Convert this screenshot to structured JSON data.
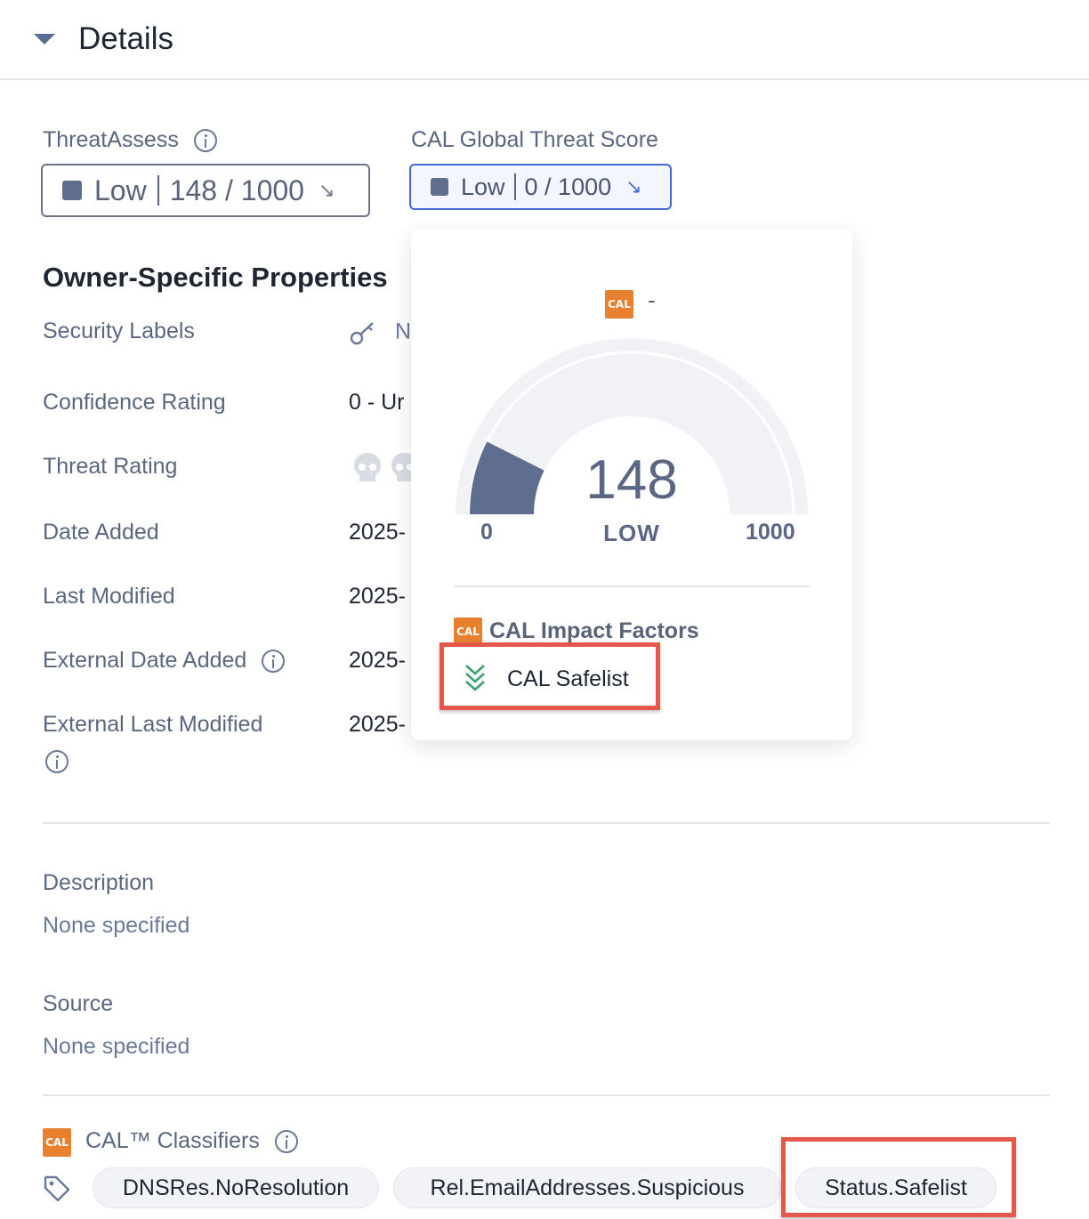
{
  "header": {
    "title": "Details"
  },
  "threat_assess": {
    "label": "ThreatAssess",
    "level": "Low",
    "score": "148 / 1000"
  },
  "cal_global": {
    "label": "CAL Global Threat Score",
    "level": "Low",
    "score": "0 / 1000"
  },
  "owner_props": {
    "title": "Owner-Specific Properties",
    "rows": [
      {
        "label": "Security Labels",
        "value": "N"
      },
      {
        "label": "Confidence Rating",
        "value": "0 - Ur"
      },
      {
        "label": "Threat Rating",
        "value": ""
      },
      {
        "label": "Date Added",
        "value": "2025-"
      },
      {
        "label": "Last Modified",
        "value": "2025-"
      },
      {
        "label": "External Date Added",
        "value": "2025-"
      },
      {
        "label": "External Last Modified",
        "value": "2025-"
      }
    ]
  },
  "description": {
    "label": "Description",
    "value": "None specified"
  },
  "source": {
    "label": "Source",
    "value": "None specified"
  },
  "classifiers": {
    "label": "CAL™ Classifiers",
    "logo_text": "CAL",
    "tags": [
      "DNSRes.NoResolution",
      "Rel.EmailAddresses.Suspicious",
      "Status.Safelist"
    ]
  },
  "popover": {
    "logo_text": "CAL",
    "header_value": "-",
    "gauge": {
      "value": "148",
      "level": "LOW",
      "min": "0",
      "max": "1000",
      "fraction": 0.148
    },
    "impact_title": "CAL Impact Factors",
    "impact_items": [
      "CAL Safelist"
    ]
  },
  "colors": {
    "accent": "#4667d6",
    "highlight": "#e4584b",
    "cal_brand": "#e8812f",
    "gauge_fill": "#5f6e8e",
    "safelist_green": "#3aa36b"
  },
  "icons": [
    "caret-down-icon",
    "info-icon",
    "arrow-down-right-icon",
    "key-icon",
    "skull-icon",
    "tag-icon",
    "chevrons-down-icon"
  ]
}
